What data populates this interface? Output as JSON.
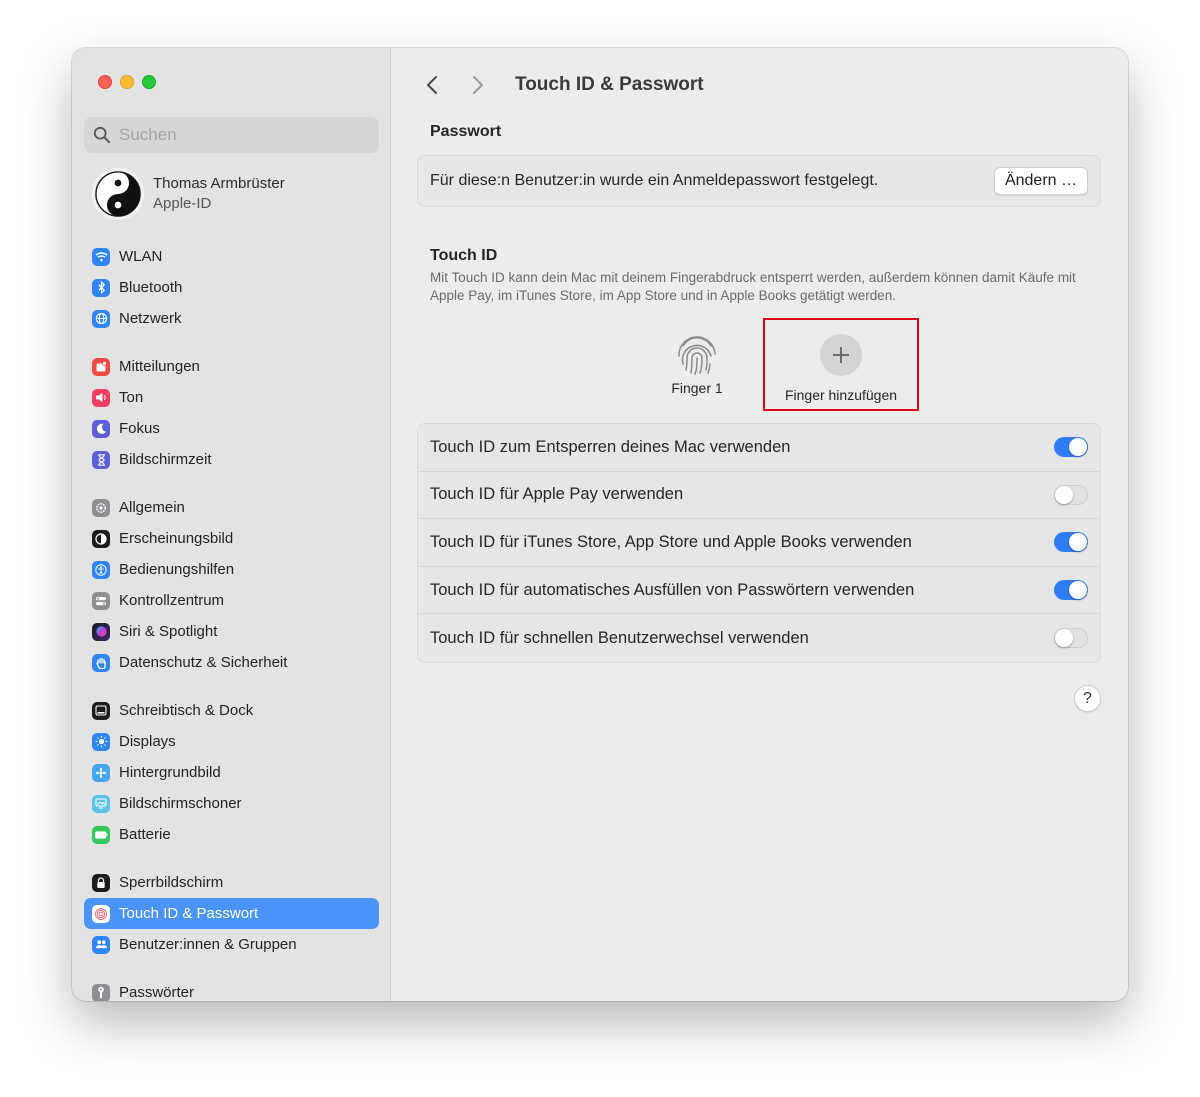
{
  "search": {
    "placeholder": "Suchen"
  },
  "profile": {
    "name": "Thomas Armbrüster",
    "subtitle": "Apple-ID"
  },
  "sidebar": {
    "group1": [
      {
        "label": "WLAN",
        "icon": "wifi-icon",
        "color": "#2f85f5"
      },
      {
        "label": "Bluetooth",
        "icon": "bluetooth-icon",
        "color": "#2f85f5"
      },
      {
        "label": "Netzwerk",
        "icon": "globe-icon",
        "color": "#2f85f5"
      }
    ],
    "group2": [
      {
        "label": "Mitteilungen",
        "icon": "notifications-icon",
        "color": "#f04a45"
      },
      {
        "label": "Ton",
        "icon": "sound-icon",
        "color": "#f0405f"
      },
      {
        "label": "Fokus",
        "icon": "moon-icon",
        "color": "#5d5fd6"
      },
      {
        "label": "Bildschirmzeit",
        "icon": "hourglass-icon",
        "color": "#5d5fd6"
      }
    ],
    "group3": [
      {
        "label": "Allgemein",
        "icon": "gear-icon",
        "color": "#8e8e93"
      },
      {
        "label": "Erscheinungsbild",
        "icon": "appearance-icon",
        "color": "#1c1c1e"
      },
      {
        "label": "Bedienungshilfen",
        "icon": "accessibility-icon",
        "color": "#2f85f5"
      },
      {
        "label": "Kontrollzentrum",
        "icon": "control-center-icon",
        "color": "#8e8e93"
      },
      {
        "label": "Siri & Spotlight",
        "icon": "siri-icon",
        "color": "#b33be0"
      },
      {
        "label": "Datenschutz & Sicherheit",
        "icon": "hand-icon",
        "color": "#2f85f5"
      }
    ],
    "group4": [
      {
        "label": "Schreibtisch & Dock",
        "icon": "dock-icon",
        "color": "#1c1c1e"
      },
      {
        "label": "Displays",
        "icon": "brightness-icon",
        "color": "#2f85f5"
      },
      {
        "label": "Hintergrundbild",
        "icon": "wallpaper-icon",
        "color": "#45a7f0"
      },
      {
        "label": "Bildschirmschoner",
        "icon": "screensaver-icon",
        "color": "#5cc3e8"
      },
      {
        "label": "Batterie",
        "icon": "battery-icon",
        "color": "#34c759"
      }
    ],
    "group5": [
      {
        "label": "Sperrbildschirm",
        "icon": "lock-icon",
        "color": "#1c1c1e"
      },
      {
        "label": "Touch ID & Passwort",
        "icon": "fingerprint-icon",
        "color": "#f26d7d",
        "selected": true
      },
      {
        "label": "Benutzer:innen & Gruppen",
        "icon": "users-icon",
        "color": "#2f85f5"
      }
    ],
    "group6": [
      {
        "label": "Passwörter",
        "icon": "key-icon",
        "color": "#8e8e93"
      }
    ]
  },
  "header": {
    "title": "Touch ID & Passwort"
  },
  "password": {
    "section_title": "Passwort",
    "text": "Für diese:n Benutzer:in wurde ein Anmeldepasswort festgelegt.",
    "button": "Ändern …"
  },
  "touchid": {
    "section_title": "Touch ID",
    "description": "Mit Touch ID kann dein Mac mit deinem Fingerabdruck entsperrt werden, außerdem können damit Käufe mit Apple Pay, im iTunes Store, im App Store und in Apple Books getätigt werden.",
    "finger1": "Finger 1",
    "add_finger": "Finger hinzufügen",
    "options": [
      {
        "label": "Touch ID zum Entsperren deines Mac verwenden",
        "on": true
      },
      {
        "label": "Touch ID für Apple Pay verwenden",
        "on": false
      },
      {
        "label": "Touch ID für iTunes Store, App Store und Apple Books verwenden",
        "on": true
      },
      {
        "label": "Touch ID für automatisches Ausfüllen von Passwörtern verwenden",
        "on": true
      },
      {
        "label": "Touch ID für schnellen Benutzerwechsel verwenden",
        "on": false
      }
    ]
  },
  "help": {
    "label": "?"
  },
  "colors": {
    "accent": "#2f7cf6",
    "highlight_box": "#d9001b",
    "selection": "#4a94f7"
  }
}
